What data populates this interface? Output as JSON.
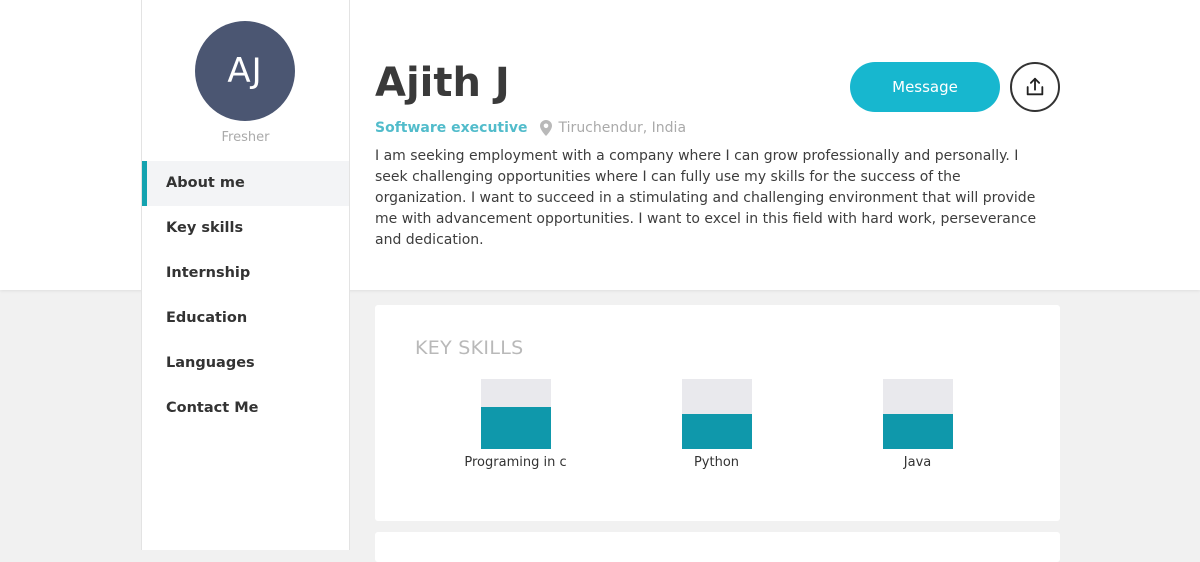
{
  "profile": {
    "initials": "AJ",
    "status": "Fresher",
    "name": "Ajith J",
    "role": "Software executive",
    "location": "Tiruchendur, India",
    "about": "I am seeking employment with a company where I can grow professionally and personally. I seek challenging opportunities where I can fully use my skills for the success of the organization. I want to succeed in a stimulating and challenging environment that will provide me with advancement opportunities. I want to excel in this field with hard work, perseverance and dedication."
  },
  "sidebar": {
    "items": [
      {
        "label": "About me",
        "active": true
      },
      {
        "label": "Key skills"
      },
      {
        "label": "Internship"
      },
      {
        "label": "Education"
      },
      {
        "label": "Languages"
      },
      {
        "label": "Contact Me"
      }
    ]
  },
  "actions": {
    "message_label": "Message",
    "share_icon": "share-upload-icon"
  },
  "icons": {
    "location": "map-pin-icon"
  },
  "key_skills": {
    "title": "KEY SKILLS",
    "skills": [
      {
        "label": "Programing in c",
        "level": 0.6
      },
      {
        "label": "Python",
        "level": 0.5
      },
      {
        "label": "Java",
        "level": 0.5
      }
    ]
  },
  "colors": {
    "accent": "#17b7cf",
    "bar_fill": "#0f98ab",
    "avatar_bg": "#4b5672",
    "role_text": "#52bccb"
  }
}
